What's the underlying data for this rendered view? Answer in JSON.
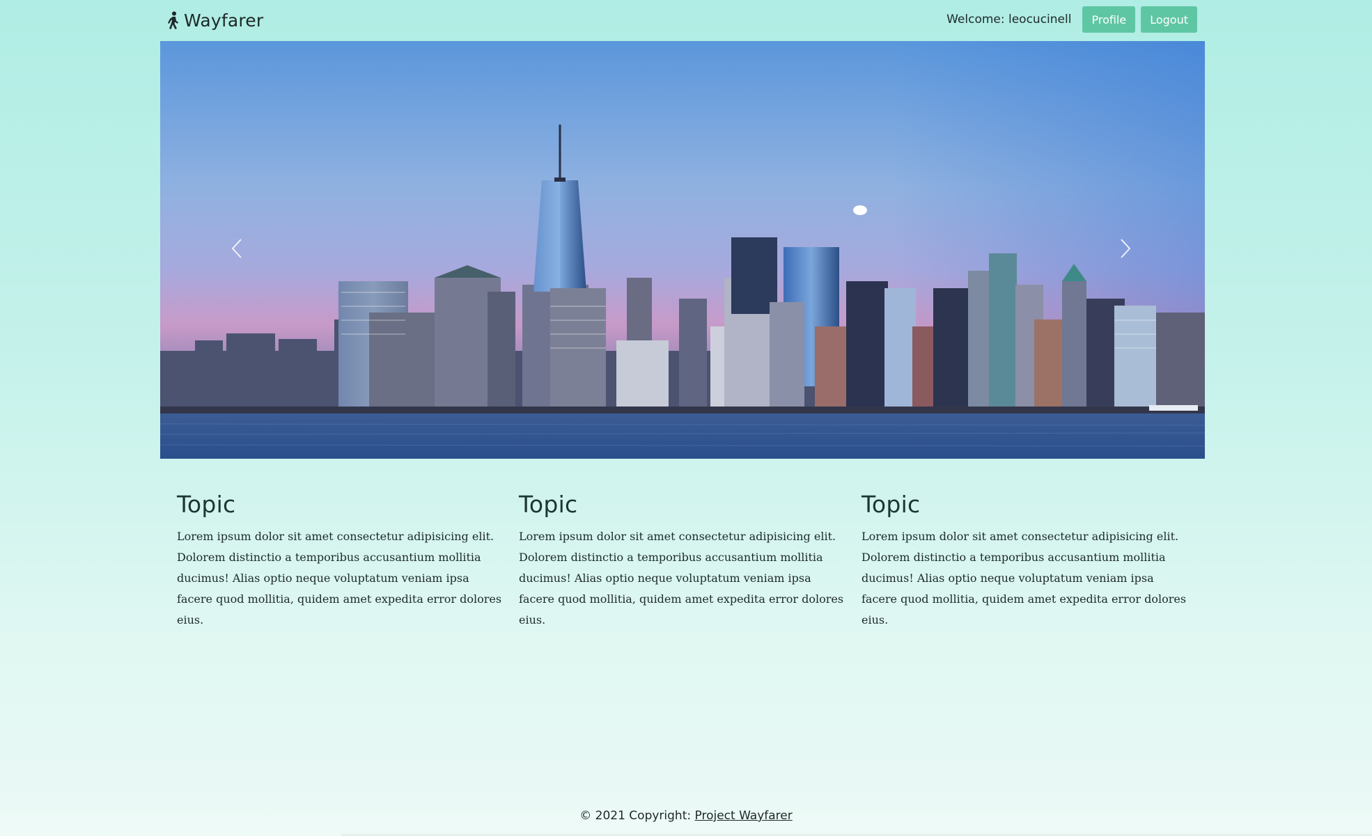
{
  "navbar": {
    "brand": "Wayfarer",
    "brand_icon": "person-walking-icon",
    "welcome": "Welcome: leocucinell",
    "profile_label": "Profile",
    "logout_label": "Logout"
  },
  "carousel": {
    "prev_icon": "chevron-left-icon",
    "next_icon": "chevron-right-icon"
  },
  "topics": [
    {
      "title": "Topic",
      "body": "Lorem ipsum dolor sit amet consectetur adipisicing elit. Dolorem distinctio a temporibus accusantium mollitia ducimus! Alias optio neque voluptatum veniam ipsa facere quod mollitia, quidem amet expedita error dolores eius."
    },
    {
      "title": "Topic",
      "body": "Lorem ipsum dolor sit amet consectetur adipisicing elit. Dolorem distinctio a temporibus accusantium mollitia ducimus! Alias optio neque voluptatum veniam ipsa facere quod mollitia, quidem amet expedita error dolores eius."
    },
    {
      "title": "Topic",
      "body": "Lorem ipsum dolor sit amet consectetur adipisicing elit. Dolorem distinctio a temporibus accusantium mollitia ducimus! Alias optio neque voluptatum veniam ipsa facere quod mollitia, quidem amet expedita error dolores eius."
    }
  ],
  "footer": {
    "prefix": "© 2021 Copyright: ",
    "link": "Project Wayfarer"
  },
  "colors": {
    "background": "#b0ede4",
    "button": "#5fc6a4",
    "text": "#1d2828"
  }
}
